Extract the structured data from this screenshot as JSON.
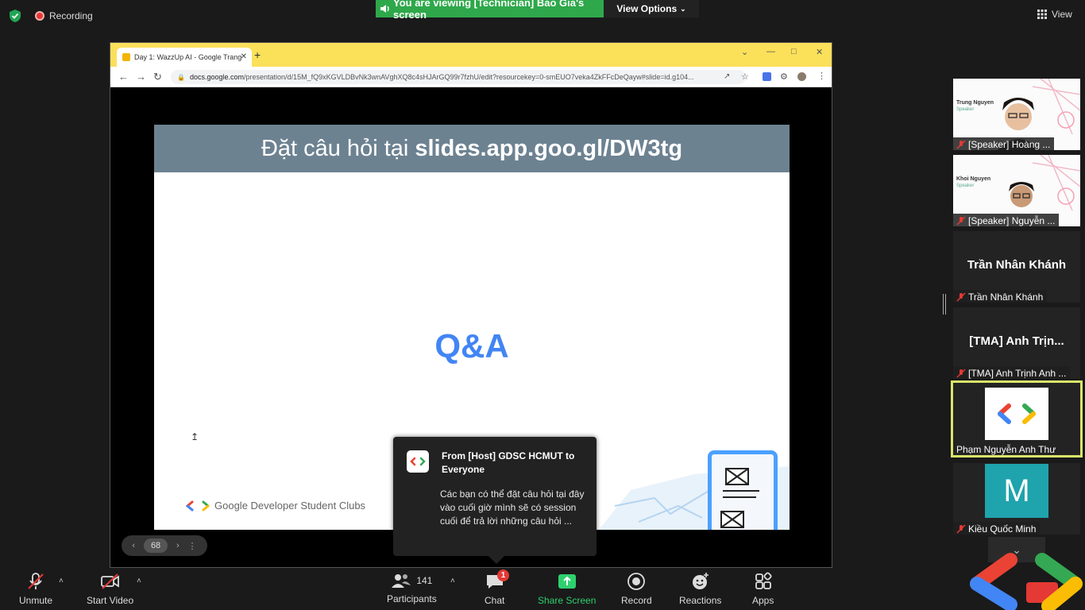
{
  "topbar": {
    "recording_label": "Recording",
    "viewing_label": "You are viewing [Technician] Bảo Gia's screen",
    "view_options_label": "View Options",
    "view_label": "View"
  },
  "browser": {
    "tab_title": "Day 1: WazzUp AI - Google Trang",
    "url_prefix": "docs.google.com",
    "url_path": "/presentation/d/15M_fQ9xKGVLDBvNk3wnAVghXQ8c4sHJArGQ99r7fzhU/edit?resourcekey=0-smEUO7veka4ZkFFcDeQayw#slide=id.g104..."
  },
  "slide": {
    "header_prefix": "Đặt câu hỏi tại",
    "header_url": "slides.app.goo.gl/DW3tg",
    "main_text": "Q&A",
    "footer_brand": "Google Developer Student Clubs",
    "page_number": "68"
  },
  "chat_notification": {
    "from": "From [Host] GDSC HCMUT to Everyone",
    "message": "Các bạn có thể đặt câu hỏi tại đây vào cuối giờ mình sẽ có session cuối để trả lời những câu hỏi ..."
  },
  "participants": [
    {
      "name": "[Speaker] Hoàng ...",
      "slide_name": "Trung Nguyen",
      "slide_role": "Speaker",
      "muted": true
    },
    {
      "name": "[Speaker] Nguyễn ...",
      "slide_name": "Khoi Nguyen",
      "slide_role": "Speaker",
      "muted": true
    },
    {
      "name": "Trần Nhân Khánh",
      "display_name": "Trần Nhân Khánh",
      "muted": true
    },
    {
      "name": "[TMA] Anh Trịnh Anh ...",
      "display_name": "[TMA] Anh Trịn...",
      "muted": true
    },
    {
      "name": "Phạm Nguyễn Anh Thư",
      "active_speaker": true
    },
    {
      "name": "Kiều Quốc Minh",
      "avatar_letter": "M",
      "muted": true
    }
  ],
  "toolbar": {
    "unmute_label": "Unmute",
    "start_video_label": "Start Video",
    "participants_label": "Participants",
    "participants_count": "141",
    "chat_label": "Chat",
    "chat_badge": "1",
    "share_screen_label": "Share Screen",
    "record_label": "Record",
    "reactions_label": "Reactions",
    "apps_label": "Apps"
  },
  "colors": {
    "viewing_banner": "#2ea84a",
    "slide_header": "#6d8291",
    "qa_text": "#4285f4",
    "active_speaker_border": "#d9e56a",
    "share_screen": "#2ed06e",
    "chat_badge": "#e53935"
  }
}
